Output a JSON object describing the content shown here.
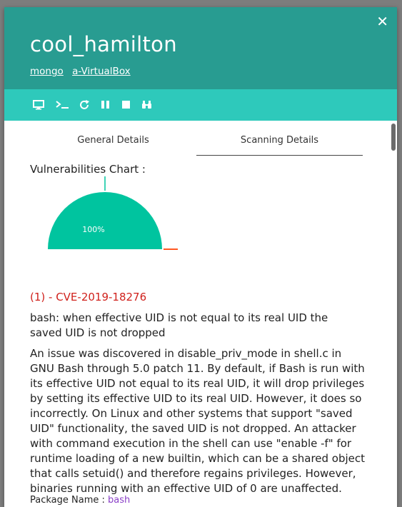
{
  "modal": {
    "title": "cool_hamilton",
    "subtitle_links": [
      "mongo",
      "a-VirtualBox"
    ],
    "close_label": "✕"
  },
  "toolbar": {
    "icons": [
      "monitor-icon",
      "terminal-icon",
      "restart-icon",
      "pause-icon",
      "stop-icon",
      "binoculars-icon"
    ]
  },
  "tabs": [
    {
      "label": "General Details",
      "active": false
    },
    {
      "label": "Scanning Details",
      "active": true
    }
  ],
  "vuln_chart": {
    "label": "Vulnerabilities Chart :"
  },
  "chart_data": {
    "type": "pie",
    "categories": [
      "",
      ""
    ],
    "values": [
      100,
      0
    ],
    "data_labels": [
      "100%",
      "0%"
    ],
    "colors": [
      "#00c49f",
      "#ff5722"
    ]
  },
  "cve": {
    "id_line": "(1) - CVE-2019-18276",
    "summary": "bash: when effective UID is not equal to its real UID the saved UID is not dropped",
    "description": "An issue was discovered in disable_priv_mode in shell.c in GNU Bash through 5.0 patch 11. By default, if Bash is run with its effective UID not equal to its real UID, it will drop privileges by setting its effective UID to its real UID. However, it does so incorrectly. On Linux and other systems that support \"saved UID\" functionality, the saved UID is not dropped. An attacker with command execution in the shell can use \"enable -f\" for runtime loading of a new builtin, which can be a shared object that calls setuid() and therefore regains privileges. However, binaries running with an effective UID of 0 are unaffected.",
    "package_label": "Package Name :",
    "package_name": "bash"
  },
  "colors": {
    "header": "#289c91",
    "toolbar": "#2ec9bb",
    "cve_id": "#d0211c",
    "package_link": "#8a3fc7"
  }
}
